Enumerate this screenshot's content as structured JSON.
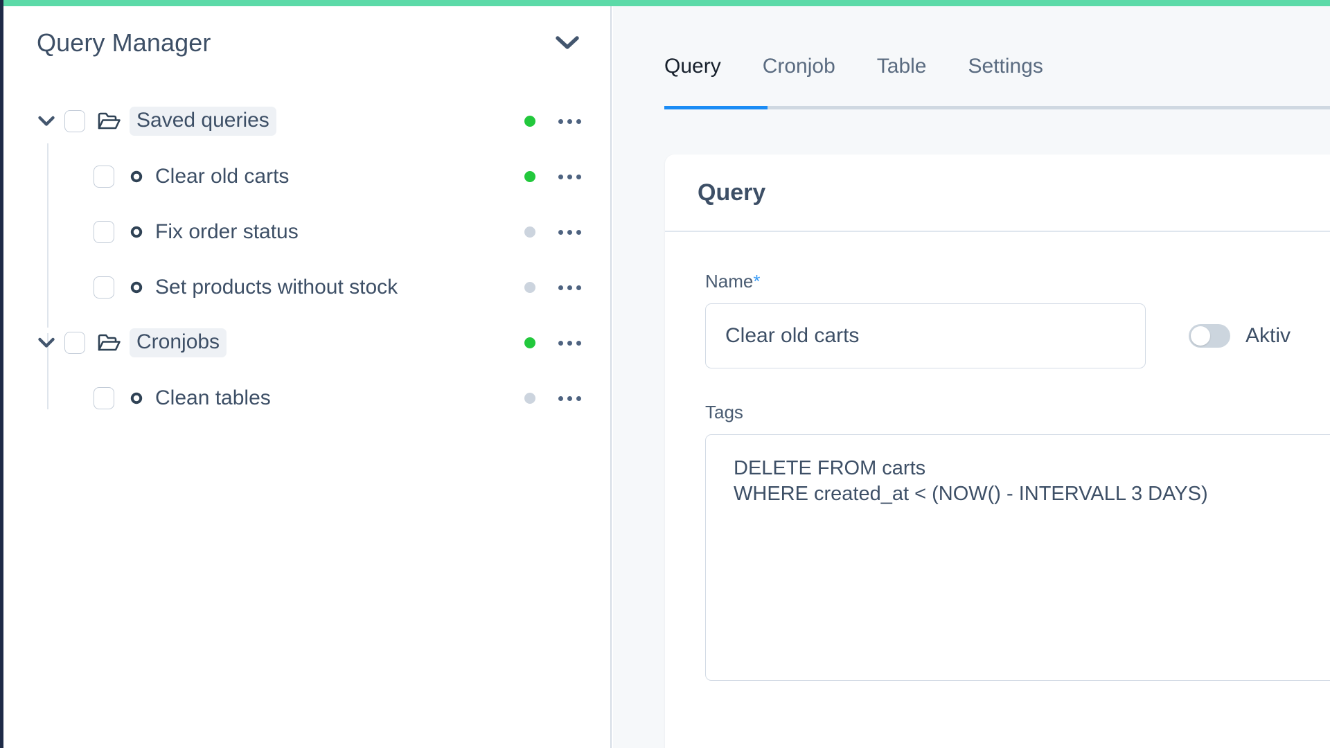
{
  "theme": {
    "accent_green": "#5cdaa8",
    "rail_navy": "#1e2b47",
    "active_tab_blue": "#1b8cf5",
    "status_on": "#22c83c",
    "status_off": "#ccd4de",
    "panel_bg": "#f6f8fa"
  },
  "sidebar": {
    "title": "Query Manager",
    "collapse_icon": "chevron-down-icon",
    "tree": [
      {
        "label": "Saved queries",
        "type": "folder",
        "icon": "folder-open-icon",
        "twisty": "chevron-down-icon",
        "status": "on",
        "menu_icon": "ellipsis-icon",
        "children": [
          {
            "label": "Clear old carts",
            "type": "query",
            "icon": "record-icon",
            "status": "on",
            "menu_icon": "ellipsis-icon"
          },
          {
            "label": "Fix order status",
            "type": "query",
            "icon": "record-icon",
            "status": "off",
            "menu_icon": "ellipsis-icon"
          },
          {
            "label": "Set products without stock",
            "type": "query",
            "icon": "record-icon",
            "status": "off",
            "menu_icon": "ellipsis-icon"
          }
        ]
      },
      {
        "label": "Cronjobs",
        "type": "folder",
        "icon": "folder-open-icon",
        "twisty": "chevron-down-icon",
        "status": "on",
        "menu_icon": "ellipsis-icon",
        "children": [
          {
            "label": "Clean tables",
            "type": "query",
            "icon": "record-icon",
            "status": "off",
            "menu_icon": "ellipsis-icon"
          }
        ]
      }
    ]
  },
  "main": {
    "tabs": [
      {
        "label": "Query",
        "active": true
      },
      {
        "label": "Cronjob",
        "active": false
      },
      {
        "label": "Table",
        "active": false
      },
      {
        "label": "Settings",
        "active": false
      }
    ],
    "card": {
      "title": "Query",
      "name_field": {
        "label": "Name",
        "required_marker": "*",
        "value": "Clear old carts",
        "placeholder": "Name"
      },
      "active_toggle": {
        "label": "Aktiv",
        "checked": false
      },
      "tags_field": {
        "label": "Tags",
        "lines": [
          "DELETE FROM carts",
          "WHERE created_at < (NOW() - INTERVALL 3 DAYS)"
        ],
        "placeholder": "Tags"
      }
    }
  }
}
